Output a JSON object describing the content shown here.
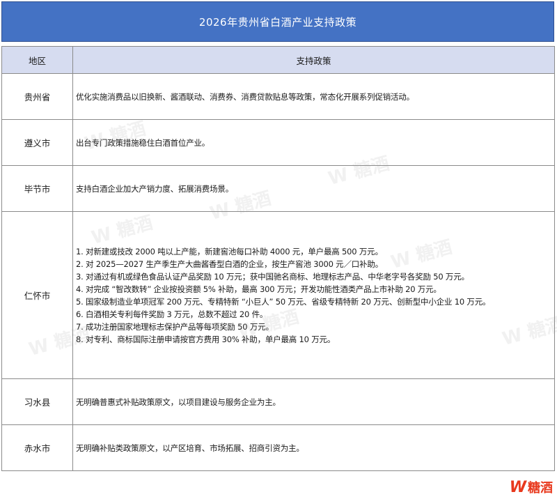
{
  "title": "2026年贵州省白酒产业支持政策",
  "headers": {
    "region": "地区",
    "policy": "支持政策"
  },
  "rows": [
    {
      "region": "贵州省",
      "lines": [
        "优化实施消费品以旧换新、酱酒联动、消费券、消费贷款贴息等政策，常态化开展系列促销活动。"
      ]
    },
    {
      "region": "遵义市",
      "lines": [
        "出台专门政策措施稳住白酒首位产业。"
      ]
    },
    {
      "region": "毕节市",
      "lines": [
        "支持白酒企业加大产销力度、拓展消费场景。"
      ]
    },
    {
      "region": "仁怀市",
      "lines": [
        "1. 对新建或技改 2000 吨以上产能，新建窖池每口补助 4000 元，单户最高 500 万元。",
        "2. 对 2025—2027 生产季生产大曲酱香型白酒的企业，按生产窖池 3000 元／口补助。",
        "3. 对通过有机或绿色食品认证产品奖励 10 万元；获中国驰名商标、地理标志产品、中华老字号各奖励 50 万元。",
        "4. 对完成 “智改数转” 企业按投资额 5% 补助，最高 300 万元；开发功能性酒类产品上市补助 20 万元。",
        "5. 国家级制造业单项冠军 200 万元、专精特新 “小巨人” 50 万元、省级专精特新 20 万元、创新型中小企业 10 万元。",
        "6. 白酒相关专利每件奖励 3 万元，总数不超过 20 件。",
        "7. 成功注册国家地理标志保护产品等每项奖励 50 万元。",
        "8. 对专利、商标国际注册申请按官方费用 30% 补助，单户最高 10 万元。"
      ]
    },
    {
      "region": "习水县",
      "lines": [
        "无明确普惠式补贴政策原文，以项目建设与服务企业为主。"
      ]
    },
    {
      "region": "赤水市",
      "lines": [
        "无明确补贴类政策原文，以产区培育、市场拓展、招商引资为主。"
      ]
    }
  ],
  "logo": {
    "text": "糖酒",
    "mark": "W"
  }
}
